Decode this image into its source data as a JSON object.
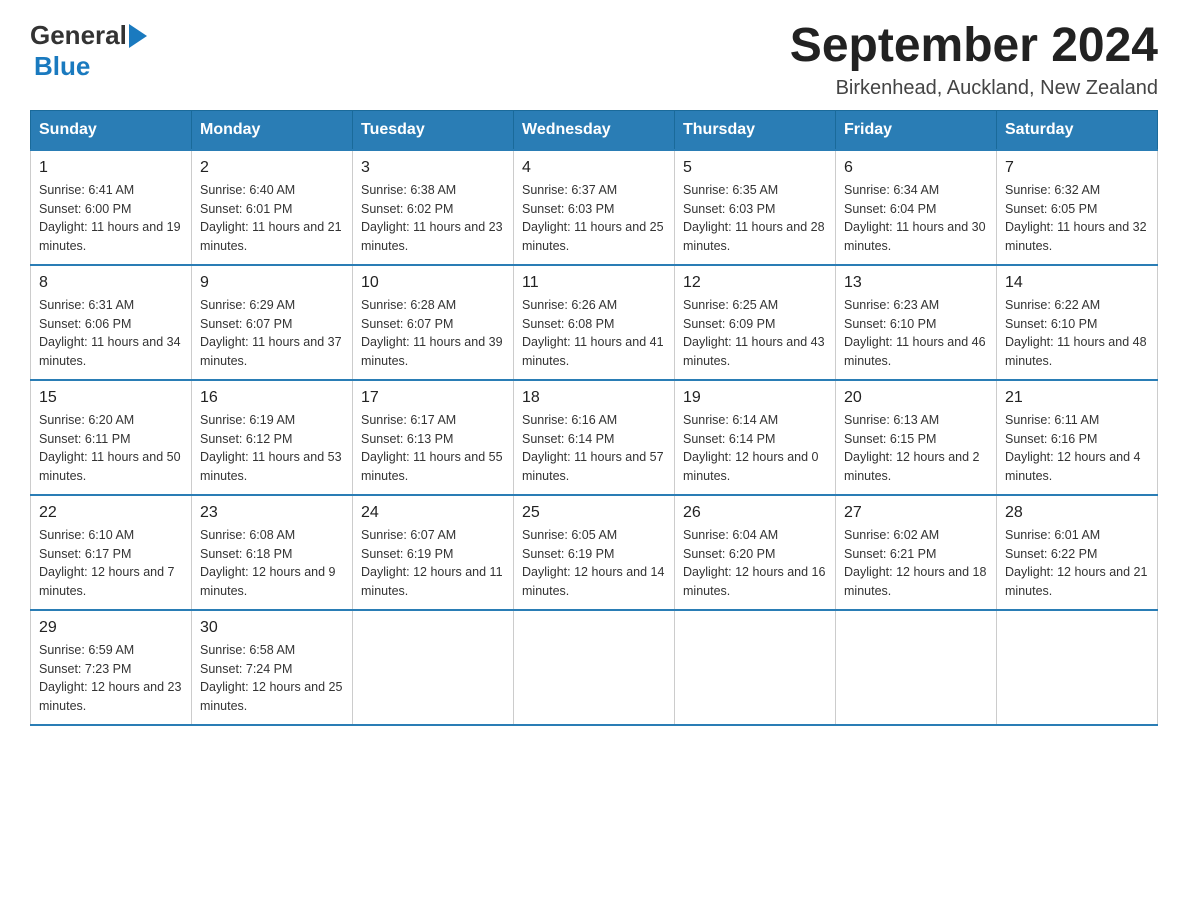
{
  "logo": {
    "general": "General",
    "blue": "Blue"
  },
  "title": "September 2024",
  "location": "Birkenhead, Auckland, New Zealand",
  "weekdays": [
    "Sunday",
    "Monday",
    "Tuesday",
    "Wednesday",
    "Thursday",
    "Friday",
    "Saturday"
  ],
  "weeks": [
    [
      {
        "day": "1",
        "sunrise": "6:41 AM",
        "sunset": "6:00 PM",
        "daylight": "11 hours and 19 minutes."
      },
      {
        "day": "2",
        "sunrise": "6:40 AM",
        "sunset": "6:01 PM",
        "daylight": "11 hours and 21 minutes."
      },
      {
        "day": "3",
        "sunrise": "6:38 AM",
        "sunset": "6:02 PM",
        "daylight": "11 hours and 23 minutes."
      },
      {
        "day": "4",
        "sunrise": "6:37 AM",
        "sunset": "6:03 PM",
        "daylight": "11 hours and 25 minutes."
      },
      {
        "day": "5",
        "sunrise": "6:35 AM",
        "sunset": "6:03 PM",
        "daylight": "11 hours and 28 minutes."
      },
      {
        "day": "6",
        "sunrise": "6:34 AM",
        "sunset": "6:04 PM",
        "daylight": "11 hours and 30 minutes."
      },
      {
        "day": "7",
        "sunrise": "6:32 AM",
        "sunset": "6:05 PM",
        "daylight": "11 hours and 32 minutes."
      }
    ],
    [
      {
        "day": "8",
        "sunrise": "6:31 AM",
        "sunset": "6:06 PM",
        "daylight": "11 hours and 34 minutes."
      },
      {
        "day": "9",
        "sunrise": "6:29 AM",
        "sunset": "6:07 PM",
        "daylight": "11 hours and 37 minutes."
      },
      {
        "day": "10",
        "sunrise": "6:28 AM",
        "sunset": "6:07 PM",
        "daylight": "11 hours and 39 minutes."
      },
      {
        "day": "11",
        "sunrise": "6:26 AM",
        "sunset": "6:08 PM",
        "daylight": "11 hours and 41 minutes."
      },
      {
        "day": "12",
        "sunrise": "6:25 AM",
        "sunset": "6:09 PM",
        "daylight": "11 hours and 43 minutes."
      },
      {
        "day": "13",
        "sunrise": "6:23 AM",
        "sunset": "6:10 PM",
        "daylight": "11 hours and 46 minutes."
      },
      {
        "day": "14",
        "sunrise": "6:22 AM",
        "sunset": "6:10 PM",
        "daylight": "11 hours and 48 minutes."
      }
    ],
    [
      {
        "day": "15",
        "sunrise": "6:20 AM",
        "sunset": "6:11 PM",
        "daylight": "11 hours and 50 minutes."
      },
      {
        "day": "16",
        "sunrise": "6:19 AM",
        "sunset": "6:12 PM",
        "daylight": "11 hours and 53 minutes."
      },
      {
        "day": "17",
        "sunrise": "6:17 AM",
        "sunset": "6:13 PM",
        "daylight": "11 hours and 55 minutes."
      },
      {
        "day": "18",
        "sunrise": "6:16 AM",
        "sunset": "6:14 PM",
        "daylight": "11 hours and 57 minutes."
      },
      {
        "day": "19",
        "sunrise": "6:14 AM",
        "sunset": "6:14 PM",
        "daylight": "12 hours and 0 minutes."
      },
      {
        "day": "20",
        "sunrise": "6:13 AM",
        "sunset": "6:15 PM",
        "daylight": "12 hours and 2 minutes."
      },
      {
        "day": "21",
        "sunrise": "6:11 AM",
        "sunset": "6:16 PM",
        "daylight": "12 hours and 4 minutes."
      }
    ],
    [
      {
        "day": "22",
        "sunrise": "6:10 AM",
        "sunset": "6:17 PM",
        "daylight": "12 hours and 7 minutes."
      },
      {
        "day": "23",
        "sunrise": "6:08 AM",
        "sunset": "6:18 PM",
        "daylight": "12 hours and 9 minutes."
      },
      {
        "day": "24",
        "sunrise": "6:07 AM",
        "sunset": "6:19 PM",
        "daylight": "12 hours and 11 minutes."
      },
      {
        "day": "25",
        "sunrise": "6:05 AM",
        "sunset": "6:19 PM",
        "daylight": "12 hours and 14 minutes."
      },
      {
        "day": "26",
        "sunrise": "6:04 AM",
        "sunset": "6:20 PM",
        "daylight": "12 hours and 16 minutes."
      },
      {
        "day": "27",
        "sunrise": "6:02 AM",
        "sunset": "6:21 PM",
        "daylight": "12 hours and 18 minutes."
      },
      {
        "day": "28",
        "sunrise": "6:01 AM",
        "sunset": "6:22 PM",
        "daylight": "12 hours and 21 minutes."
      }
    ],
    [
      {
        "day": "29",
        "sunrise": "6:59 AM",
        "sunset": "7:23 PM",
        "daylight": "12 hours and 23 minutes."
      },
      {
        "day": "30",
        "sunrise": "6:58 AM",
        "sunset": "7:24 PM",
        "daylight": "12 hours and 25 minutes."
      },
      null,
      null,
      null,
      null,
      null
    ]
  ],
  "labels": {
    "sunrise": "Sunrise:",
    "sunset": "Sunset:",
    "daylight": "Daylight:"
  }
}
